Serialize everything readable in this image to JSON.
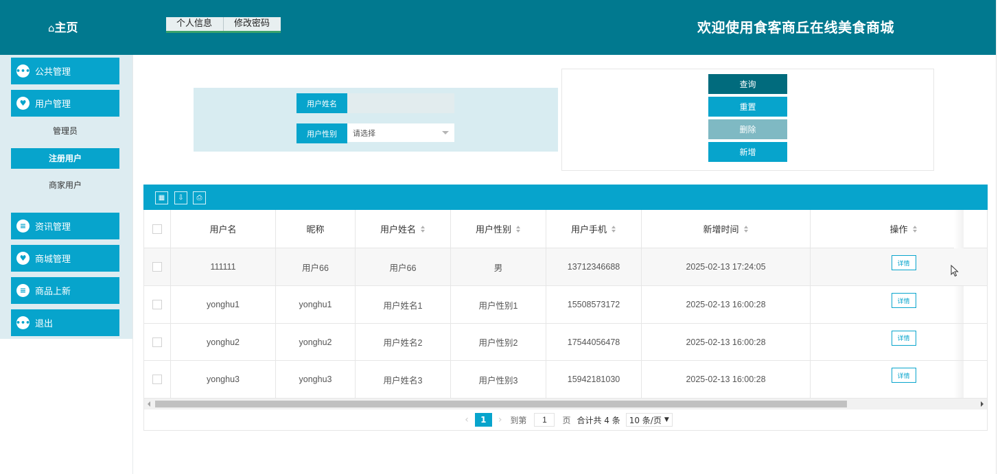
{
  "header": {
    "home_icon": "⌂",
    "home_label": "主页",
    "tabs": [
      "个人信息",
      "修改密码"
    ],
    "welcome": "欢迎使用食客商丘在线美食商城"
  },
  "sidebar": {
    "menu": [
      {
        "label": "公共管理",
        "icon": "chat-icon"
      },
      {
        "label": "用户管理",
        "icon": "heart-icon"
      },
      {
        "label": "资讯管理",
        "icon": "list-icon"
      },
      {
        "label": "商城管理",
        "icon": "heart-icon"
      },
      {
        "label": "商品上新",
        "icon": "list-icon"
      },
      {
        "label": "退出",
        "icon": "chat-icon"
      }
    ],
    "submenu": [
      {
        "label": "管理员",
        "active": false
      },
      {
        "label": "注册用户",
        "active": true
      },
      {
        "label": "商家用户",
        "active": false
      }
    ]
  },
  "search": {
    "name_label": "用户姓名",
    "name_value": "",
    "gender_label": "用户性别",
    "gender_placeholder": "请选择"
  },
  "actions": {
    "query": "查询",
    "reset": "重置",
    "delete": "删除",
    "add": "新增"
  },
  "colors": {
    "header": "#01798f",
    "accent": "#07a4cc",
    "query_btn": "#016b7d",
    "delete_btn": "#7fb9c3"
  },
  "table": {
    "toolbar_icons": [
      "columns-icon",
      "export-icon",
      "print-icon"
    ],
    "columns": [
      {
        "label": "用户名",
        "sortable": false
      },
      {
        "label": "昵称",
        "sortable": false
      },
      {
        "label": "用户姓名",
        "sortable": true
      },
      {
        "label": "用户性别",
        "sortable": true
      },
      {
        "label": "用户手机",
        "sortable": true
      },
      {
        "label": "新增时间",
        "sortable": true
      },
      {
        "label": "操作",
        "sortable": true
      }
    ],
    "detail_label": "详情",
    "rows": [
      [
        "111111",
        "用户66",
        "用户66",
        "男",
        "13712346688",
        "2025-02-13 17:24:05"
      ],
      [
        "yonghu1",
        "yonghu1",
        "用户姓名1",
        "用户性别1",
        "15508573172",
        "2025-02-13 16:00:28"
      ],
      [
        "yonghu2",
        "yonghu2",
        "用户姓名2",
        "用户性别2",
        "17544056478",
        "2025-02-13 16:00:28"
      ],
      [
        "yonghu3",
        "yonghu3",
        "用户姓名3",
        "用户性别3",
        "15942181030",
        "2025-02-13 16:00:28"
      ]
    ]
  },
  "pagination": {
    "prev": "‹",
    "current": "1",
    "next": "›",
    "goto_label": "到第",
    "goto_value": "1",
    "page_unit": "页",
    "total": "合计共 4 条",
    "page_size": "10 条/页"
  }
}
